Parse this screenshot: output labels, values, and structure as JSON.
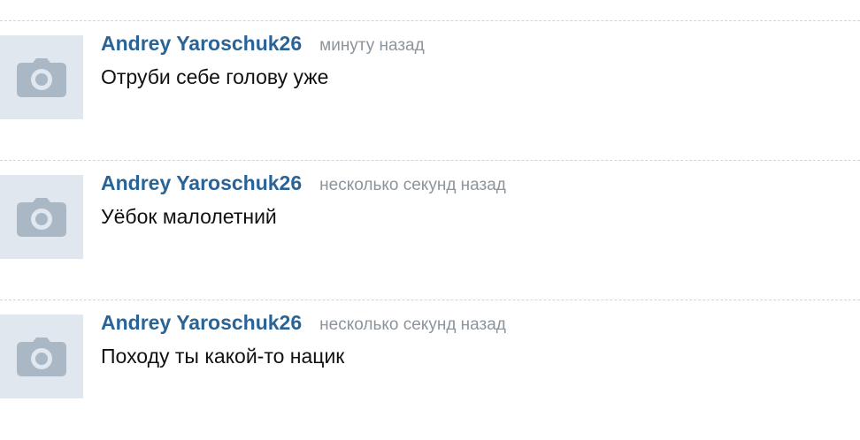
{
  "icons": {
    "avatar_placeholder": "camera-icon"
  },
  "colors": {
    "author_link": "#2a6496",
    "timestamp": "#8c949c",
    "avatar_bg": "#e1e7ee",
    "avatar_icon": "#aab7c5",
    "divider": "#cfd5dc"
  },
  "comments": [
    {
      "author": "Andrey Yaroschuk26",
      "time": "минуту назад",
      "text": "Отруби себе голову уже"
    },
    {
      "author": "Andrey Yaroschuk26",
      "time": "несколько секунд назад",
      "text": "Уёбок малолетний"
    },
    {
      "author": "Andrey Yaroschuk26",
      "time": "несколько секунд назад",
      "text": "Походу ты какой-то нацик"
    }
  ]
}
